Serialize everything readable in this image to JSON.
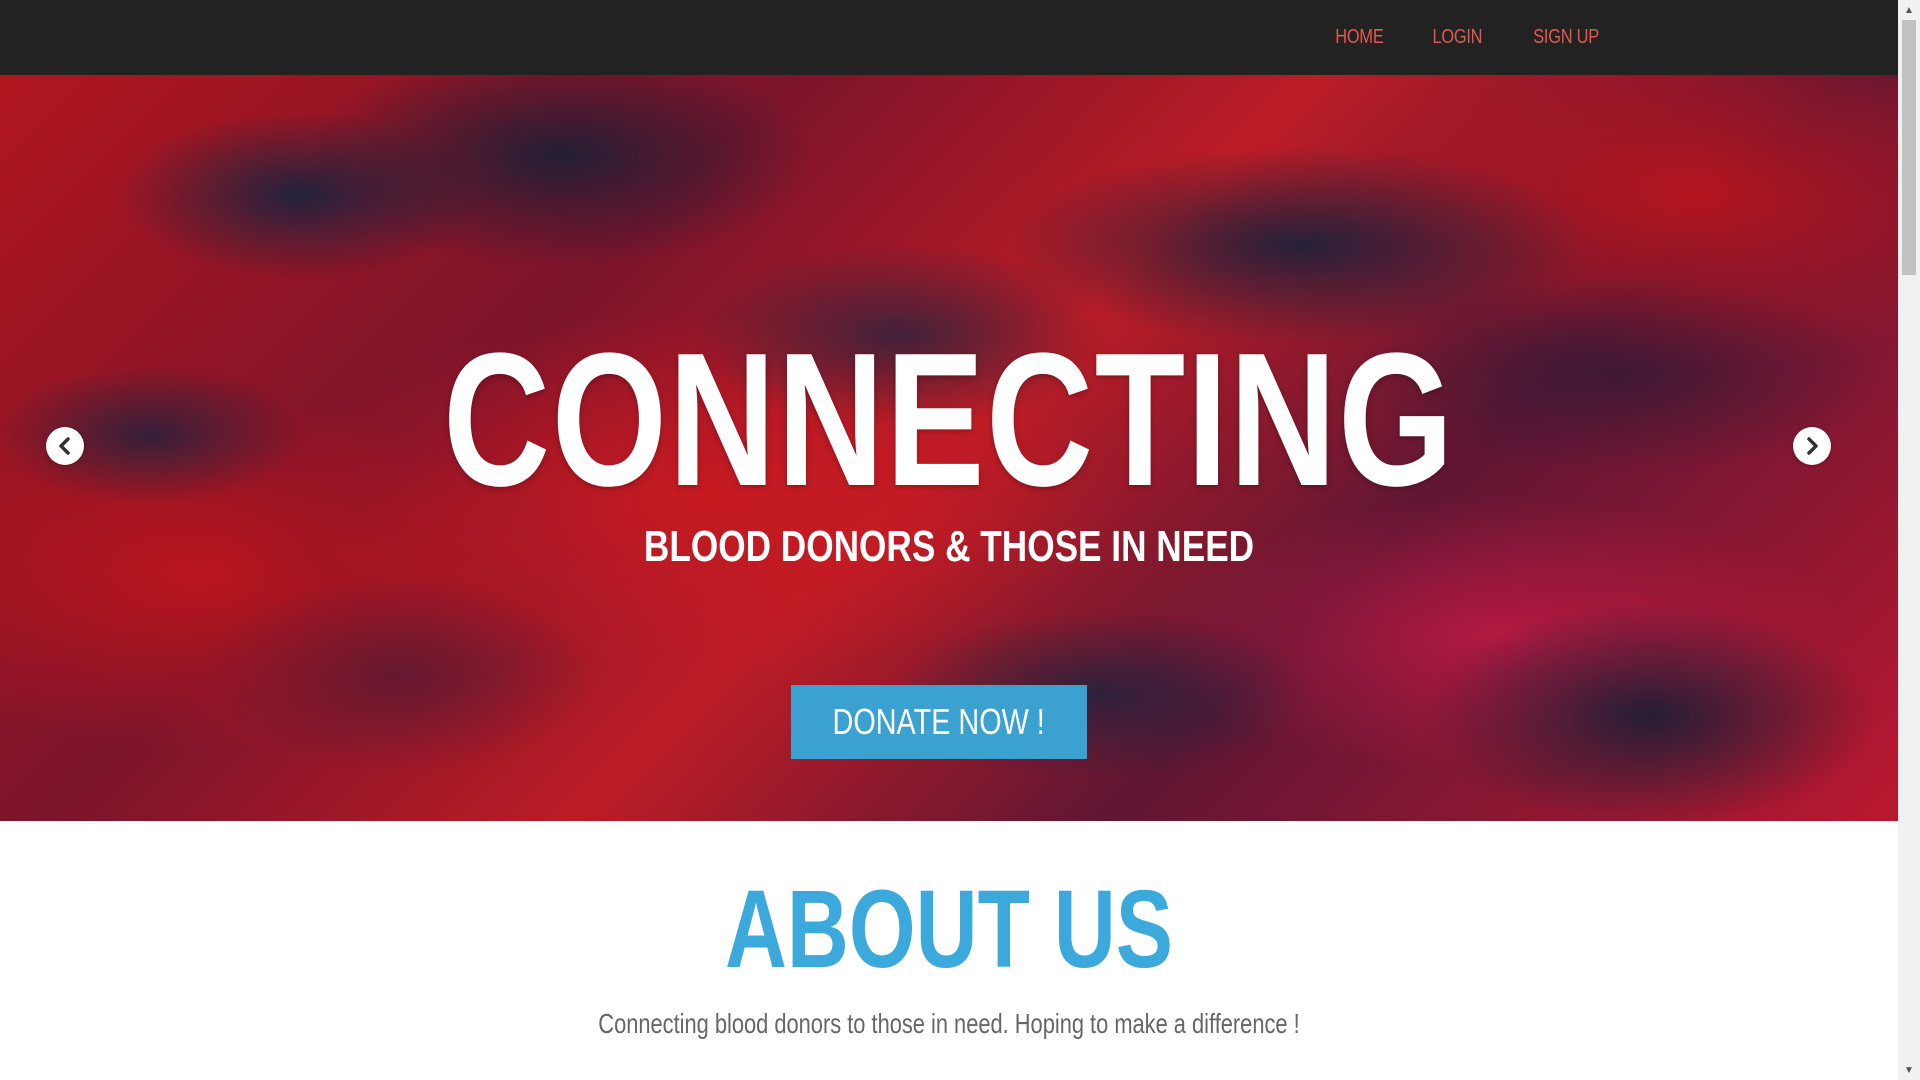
{
  "nav": {
    "links": [
      "HOME",
      "LOGIN",
      "SIGN UP"
    ],
    "link_color": "#e05a4f",
    "background": "#222222"
  },
  "hero": {
    "title": "CONNECTING",
    "subtitle": "BLOOD DONORS & THOSE IN NEED",
    "cta_label": "DONATE NOW !",
    "cta_color": "#3ba1d1",
    "prev_icon": "chevron-left-icon",
    "next_icon": "chevron-right-icon"
  },
  "about": {
    "title": "ABOUT US",
    "text": "Connecting blood donors to those in need. Hoping to make a difference !",
    "title_color": "#3ba9db"
  },
  "scrollbar": {
    "up_icon": "scroll-up-arrow-icon",
    "down_icon": "scroll-down-arrow-icon"
  }
}
